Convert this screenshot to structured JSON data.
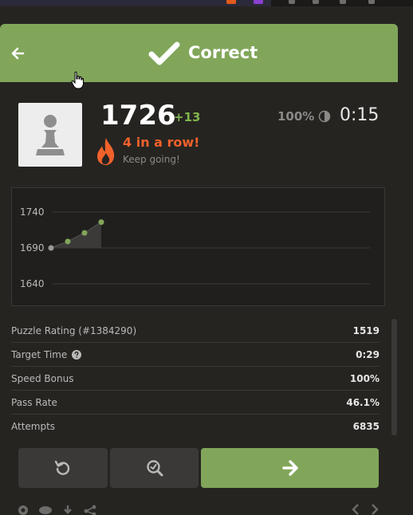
{
  "header": {
    "title": "Correct"
  },
  "player": {
    "rating": "1726",
    "rating_delta": "+13",
    "streak": "4 in a row!",
    "streak_sub": "Keep going!",
    "accuracy": "100%",
    "timer": "0:15"
  },
  "chart_data": {
    "type": "line",
    "x": [
      1,
      2,
      3,
      4
    ],
    "values": [
      1690,
      1699,
      1711,
      1726
    ],
    "tick_labels": [
      "1740",
      "1690",
      "1640"
    ],
    "ylim": [
      1640,
      1740
    ],
    "grid": true
  },
  "stats": [
    {
      "label": "Puzzle Rating (#1384290)",
      "value": "1519"
    },
    {
      "label": "Target Time",
      "value": "0:29"
    },
    {
      "label": "Speed Bonus",
      "value": "100%"
    },
    {
      "label": "Pass Rate",
      "value": "46.1%"
    },
    {
      "label": "Attempts",
      "value": "6835"
    }
  ],
  "colors": {
    "accent_green": "#81a65a",
    "streak_orange": "#f1612b",
    "delta_green": "#81b64c",
    "background": "#262421"
  },
  "icons": {
    "back": "arrow-left-icon",
    "header": "check-icon",
    "streak": "flame-icon",
    "accuracy": "half-circle-icon",
    "help": "question-circle-icon",
    "retry": "retry-icon",
    "analyze": "magnifier-icon",
    "next": "arrow-right-icon"
  }
}
